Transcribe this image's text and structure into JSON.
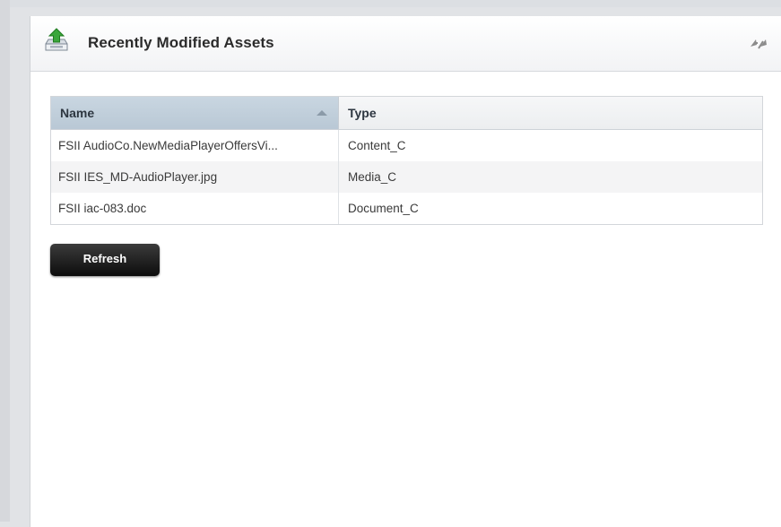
{
  "panel": {
    "title": "Recently Modified Assets",
    "header_icon": "upload-tray-icon",
    "collapse_icon": "collapse-arrows-icon"
  },
  "table": {
    "columns": [
      "Name",
      "Type"
    ],
    "sort": {
      "column": "Name",
      "direction": "ascending"
    },
    "rows": [
      {
        "name": "FSII AudioCo.NewMediaPlayerOffersVi...",
        "type": "Content_C"
      },
      {
        "name": "FSII IES_MD-AudioPlayer.jpg",
        "type": "Media_C"
      },
      {
        "name": "FSII iac-083.doc",
        "type": "Document_C"
      }
    ]
  },
  "actions": {
    "refresh_label": "Refresh"
  },
  "colors": {
    "header_sorted": "#c3d1dd",
    "button": "#1a1a1a",
    "icon_green": "#3aa63a"
  }
}
